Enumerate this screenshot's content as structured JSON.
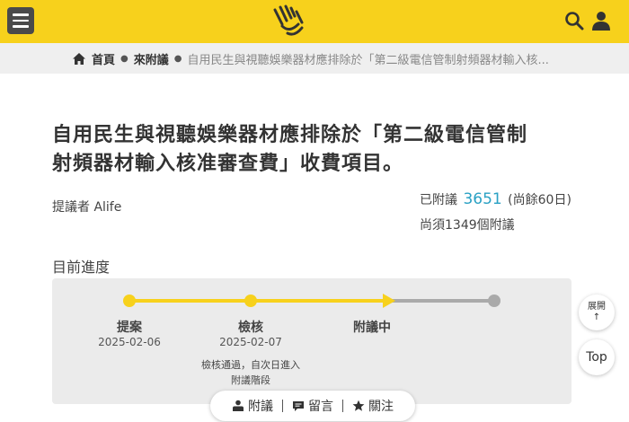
{
  "header": {
    "menu_icon": "hamburger-menu-icon",
    "logo_icon": "hands-logo-icon",
    "search_icon": "search-icon",
    "user_icon": "user-icon",
    "brand_color": "#f7d11c"
  },
  "breadcrumb": {
    "home": "首頁",
    "section": "來附議",
    "current": "自用民生與視聽娛樂器材應排除於「第二級電信管制射頻器材輸入核..."
  },
  "proposal": {
    "title_line1": "自用民生與視聽娛樂器材應排除於「第二級電信管制",
    "title_line2": "射頻器材輸入核准審查費」收費項目。",
    "proposer": "提議者 Alife",
    "signed_label": "已附議",
    "signed_count": "3651",
    "days_left": "(尚餘60日)",
    "remaining": "尚須1349個附議"
  },
  "progress": {
    "label": "目前進度",
    "steps": [
      {
        "name": "提案",
        "date": "2025-02-06",
        "done": true
      },
      {
        "name": "檢核",
        "date": "2025-02-07",
        "note_line1": "檢核通過，自次日進入",
        "note_line2": "附議階段",
        "done": true
      },
      {
        "name": "附議中",
        "done": true,
        "current": true
      },
      {
        "name": "",
        "done": false
      }
    ]
  },
  "actions": {
    "second": "附議",
    "comment": "留言",
    "follow": "關注"
  },
  "side": {
    "expand_line1": "展開",
    "expand_arrow": "↑",
    "top": "Top"
  }
}
